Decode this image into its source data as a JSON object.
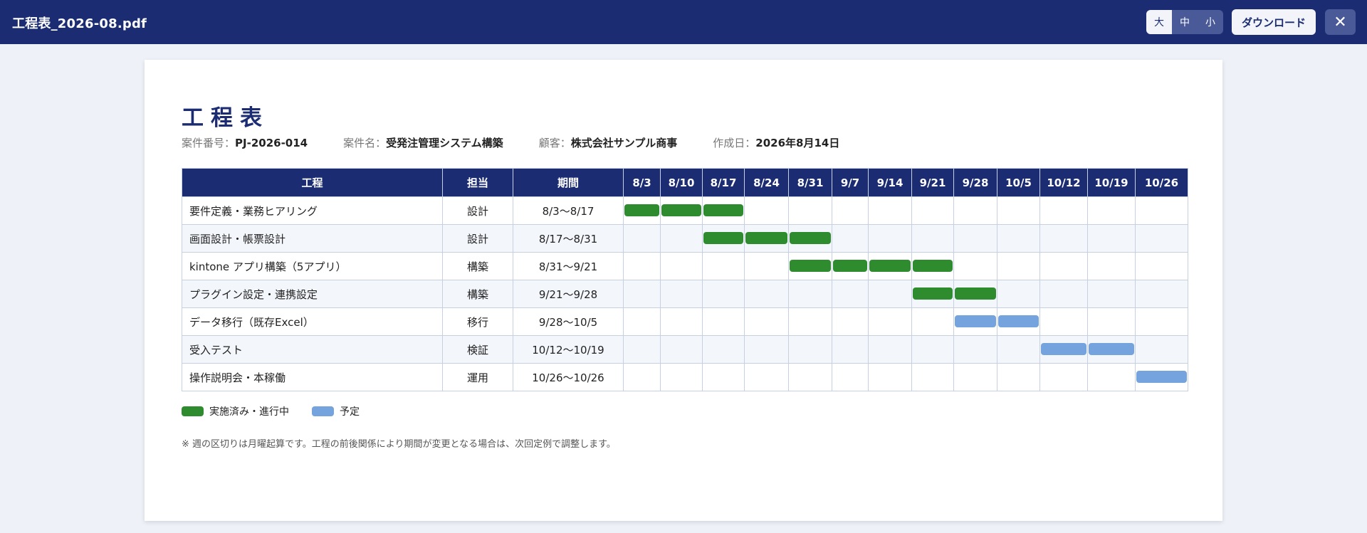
{
  "topbar": {
    "file_title": "工程表_2026-08.pdf",
    "size_options": [
      "大",
      "中",
      "小"
    ],
    "size_selected": "大",
    "download_label": "ダウンロード",
    "close_glyph": "✕"
  },
  "document": {
    "title": "工程表",
    "meta": [
      {
        "label": "案件番号：",
        "value": "PJ-2026-014"
      },
      {
        "label": "案件名：",
        "value": "受発注管理システム構築"
      },
      {
        "label": "顧客：",
        "value": "株式会社サンプル商事"
      },
      {
        "label": "作成日：",
        "value": "2026年8月14日"
      }
    ],
    "table": {
      "headers": [
        "工程",
        "担当",
        "期間"
      ],
      "weeks": [
        "8/3",
        "8/10",
        "8/17",
        "8/24",
        "8/31",
        "9/7",
        "9/14",
        "9/21",
        "9/28",
        "10/5",
        "10/12",
        "10/19",
        "10/26"
      ],
      "rows": [
        {
          "task": "要件定義・業務ヒアリング",
          "owner": "設計",
          "period": "8/3〜8/17",
          "bars": [
            {
              "week": 0,
              "status": "done"
            },
            {
              "week": 1,
              "status": "done"
            },
            {
              "week": 2,
              "status": "done"
            }
          ]
        },
        {
          "task": "画面設計・帳票設計",
          "owner": "設計",
          "period": "8/17〜8/31",
          "bars": [
            {
              "week": 2,
              "status": "done"
            },
            {
              "week": 3,
              "status": "done"
            },
            {
              "week": 4,
              "status": "done"
            }
          ]
        },
        {
          "task": "kintone アプリ構築（5アプリ）",
          "owner": "構築",
          "period": "8/31〜9/21",
          "bars": [
            {
              "week": 4,
              "status": "done"
            },
            {
              "week": 5,
              "status": "done"
            },
            {
              "week": 6,
              "status": "done"
            },
            {
              "week": 7,
              "status": "done"
            }
          ]
        },
        {
          "task": "プラグイン設定・連携設定",
          "owner": "構築",
          "period": "9/21〜9/28",
          "bars": [
            {
              "week": 7,
              "status": "done"
            },
            {
              "week": 8,
              "status": "done"
            }
          ]
        },
        {
          "task": "データ移行（既存Excel）",
          "owner": "移行",
          "period": "9/28〜10/5",
          "bars": [
            {
              "week": 8,
              "status": "plan"
            },
            {
              "week": 9,
              "status": "plan"
            }
          ]
        },
        {
          "task": "受入テスト",
          "owner": "検証",
          "period": "10/12〜10/19",
          "bars": [
            {
              "week": 10,
              "status": "plan"
            },
            {
              "week": 11,
              "status": "plan"
            }
          ]
        },
        {
          "task": "操作説明会・本稼働",
          "owner": "運用",
          "period": "10/26〜10/26",
          "bars": [
            {
              "week": 12,
              "status": "plan"
            }
          ]
        }
      ]
    },
    "legend": [
      {
        "label": "実施済み・進行中",
        "status": "done",
        "color": "#2e8b2e"
      },
      {
        "label": "予定",
        "status": "plan",
        "color": "#74a3de"
      }
    ],
    "note": "※ 週の区切りは月曜起算です。工程の前後関係により期間が変更となる場合は、次回定例で調整します。"
  },
  "colors": {
    "header_navy": "#1b2c72",
    "done_green": "#2e8b2e",
    "plan_blue": "#74a3de"
  }
}
